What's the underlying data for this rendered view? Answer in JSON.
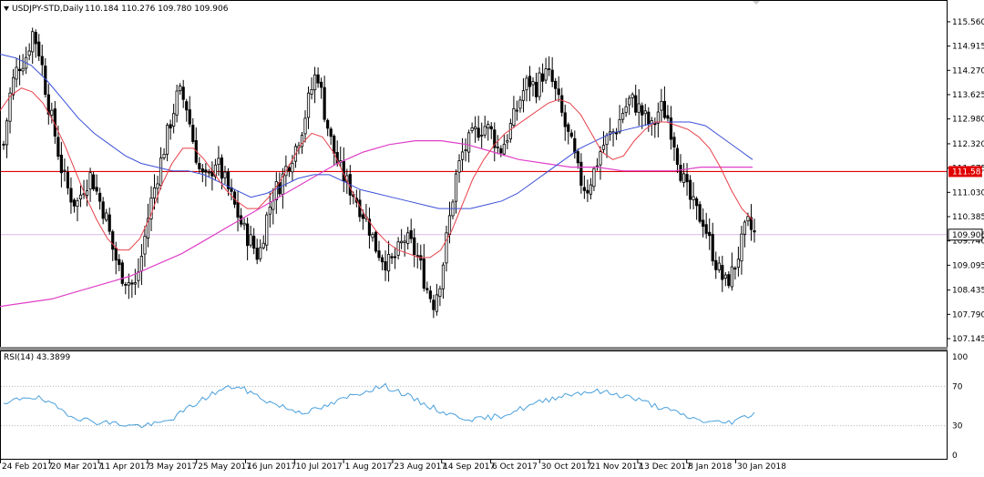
{
  "window": {
    "symbol_title": "USDJPY-STD,Daily",
    "ohlc": "110.184 110.276 109.780 109.906"
  },
  "indicator": {
    "label": "RSI(14) 43.3899"
  },
  "colors": {
    "candle": "#000000",
    "ma_fast": "#e8404a",
    "ma_slow": "#3a4fd8",
    "ma_long": "#e040c8",
    "hline": "#e00000",
    "current_price_line": "#d8b8e8",
    "rsi_line": "#4aa0dc",
    "grid_dot": "#b8b8b8",
    "hline_label_bg": "#e00000",
    "price_label_bg": "#ffffff"
  },
  "chart_data": [
    {
      "type": "candlestick",
      "ylim": [
        107.0,
        115.8
      ],
      "price_axis_ticks": [
        "115.560",
        "114.915",
        "114.270",
        "113.625",
        "112.980",
        "112.320",
        "111.675",
        "111.030",
        "110.385",
        "109.740",
        "109.095",
        "108.435",
        "107.790",
        "107.145"
      ],
      "highlight_labels": {
        "hline": "111.583",
        "last_price": "109.906"
      },
      "hline_value": 111.583,
      "last_price": 109.906,
      "date_ticks": [
        "24 Feb 2017",
        "20 Mar 2017",
        "11 Apr 2017",
        "3 May 2017",
        "25 May 2017",
        "16 Jun 2017",
        "10 Jul 2017",
        "1 Aug 2017",
        "23 Aug 2017",
        "14 Sep 2017",
        "6 Oct 2017",
        "30 Oct 2017",
        "21 Nov 2017",
        "13 Dec 2017",
        "8 Jan 2018",
        "30 Jan 2018"
      ],
      "close_path": [
        112.3,
        113.8,
        114.4,
        114.6,
        115.3,
        114.7,
        113.5,
        112.6,
        111.6,
        111.0,
        110.7,
        111.2,
        111.5,
        110.9,
        110.4,
        109.5,
        108.9,
        108.7,
        108.5,
        109.4,
        110.6,
        111.4,
        112.2,
        113.0,
        113.7,
        113.4,
        112.4,
        111.5,
        111.3,
        111.9,
        111.5,
        111.0,
        110.5,
        110.0,
        109.7,
        109.3,
        110.3,
        111.0,
        111.3,
        111.8,
        112.2,
        112.8,
        113.6,
        114.3,
        113.2,
        112.3,
        111.7,
        111.3,
        111.0,
        110.6,
        110.2,
        109.6,
        109.3,
        109.1,
        109.4,
        109.8,
        109.6,
        109.2,
        108.5,
        108.1,
        108.8,
        110.1,
        111.4,
        112.1,
        112.4,
        112.7,
        112.8,
        112.6,
        112.1,
        112.5,
        113.0,
        113.6,
        114.0,
        113.8,
        114.2,
        114.1,
        113.5,
        112.8,
        112.2,
        111.4,
        111.1,
        111.6,
        112.2,
        112.5,
        112.7,
        113.2,
        113.5,
        113.3,
        113.0,
        112.7,
        113.3,
        113.1,
        112.4,
        111.5,
        110.9,
        110.5,
        110.3,
        109.6,
        109.0,
        108.6,
        108.9,
        109.5,
        110.2,
        109.906
      ],
      "ma_fast": [
        113.2,
        113.6,
        113.8,
        113.7,
        113.4,
        112.9,
        112.3,
        111.6,
        110.9,
        110.3,
        109.8,
        109.5,
        109.5,
        109.8,
        110.4,
        111.2,
        111.8,
        112.2,
        112.2,
        111.9,
        111.5,
        111.1,
        110.8,
        110.6,
        110.6,
        110.9,
        111.3,
        111.8,
        112.3,
        112.6,
        112.5,
        112.1,
        111.5,
        110.9,
        110.4,
        110.0,
        109.7,
        109.5,
        109.4,
        109.3,
        109.3,
        109.5,
        110.0,
        110.7,
        111.4,
        111.9,
        112.3,
        112.6,
        112.8,
        113.0,
        113.2,
        113.4,
        113.5,
        113.4,
        113.1,
        112.6,
        112.1,
        111.9,
        112.0,
        112.4,
        112.7,
        112.9,
        112.9,
        112.8,
        112.7,
        112.5,
        112.2,
        111.7,
        111.1,
        110.6,
        110.3
      ],
      "ma_slow": [
        114.7,
        114.6,
        114.4,
        114.0,
        113.5,
        113.0,
        112.6,
        112.3,
        112.0,
        111.8,
        111.7,
        111.6,
        111.6,
        111.5,
        111.3,
        111.1,
        110.9,
        111.0,
        111.2,
        111.4,
        111.5,
        111.5,
        111.3,
        111.1,
        111.0,
        110.9,
        110.8,
        110.7,
        110.6,
        110.6,
        110.6,
        110.7,
        110.8,
        111.0,
        111.3,
        111.6,
        111.9,
        112.2,
        112.4,
        112.6,
        112.7,
        112.8,
        112.9,
        112.9,
        112.9,
        112.8,
        112.5,
        112.2,
        111.9
      ],
      "ma_long": [
        108.0,
        108.1,
        108.2,
        108.4,
        108.6,
        108.8,
        109.1,
        109.4,
        109.8,
        110.2,
        110.6,
        111.0,
        111.4,
        111.8,
        112.1,
        112.3,
        112.4,
        112.4,
        112.3,
        112.1,
        111.9,
        111.8,
        111.7,
        111.7,
        111.6,
        111.6,
        111.6,
        111.7,
        111.7,
        111.7
      ]
    },
    {
      "type": "line",
      "ylim": [
        0,
        100
      ],
      "axis_ticks": [
        "100",
        "70",
        "30",
        "0"
      ],
      "levels": [
        70,
        30
      ],
      "last_value": 43.3899,
      "rsi_path": [
        50,
        56,
        60,
        58,
        52,
        46,
        40,
        36,
        34,
        33,
        32,
        30,
        30,
        31,
        34,
        40,
        48,
        55,
        62,
        67,
        70,
        66,
        60,
        54,
        50,
        46,
        44,
        46,
        50,
        55,
        60,
        64,
        68,
        70,
        66,
        60,
        54,
        49,
        44,
        40,
        38,
        36,
        38,
        40,
        44,
        48,
        52,
        56,
        60,
        62,
        64,
        65,
        64,
        62,
        60,
        56,
        52,
        48,
        44,
        40,
        36,
        34,
        33,
        34,
        38,
        43
      ]
    }
  ]
}
